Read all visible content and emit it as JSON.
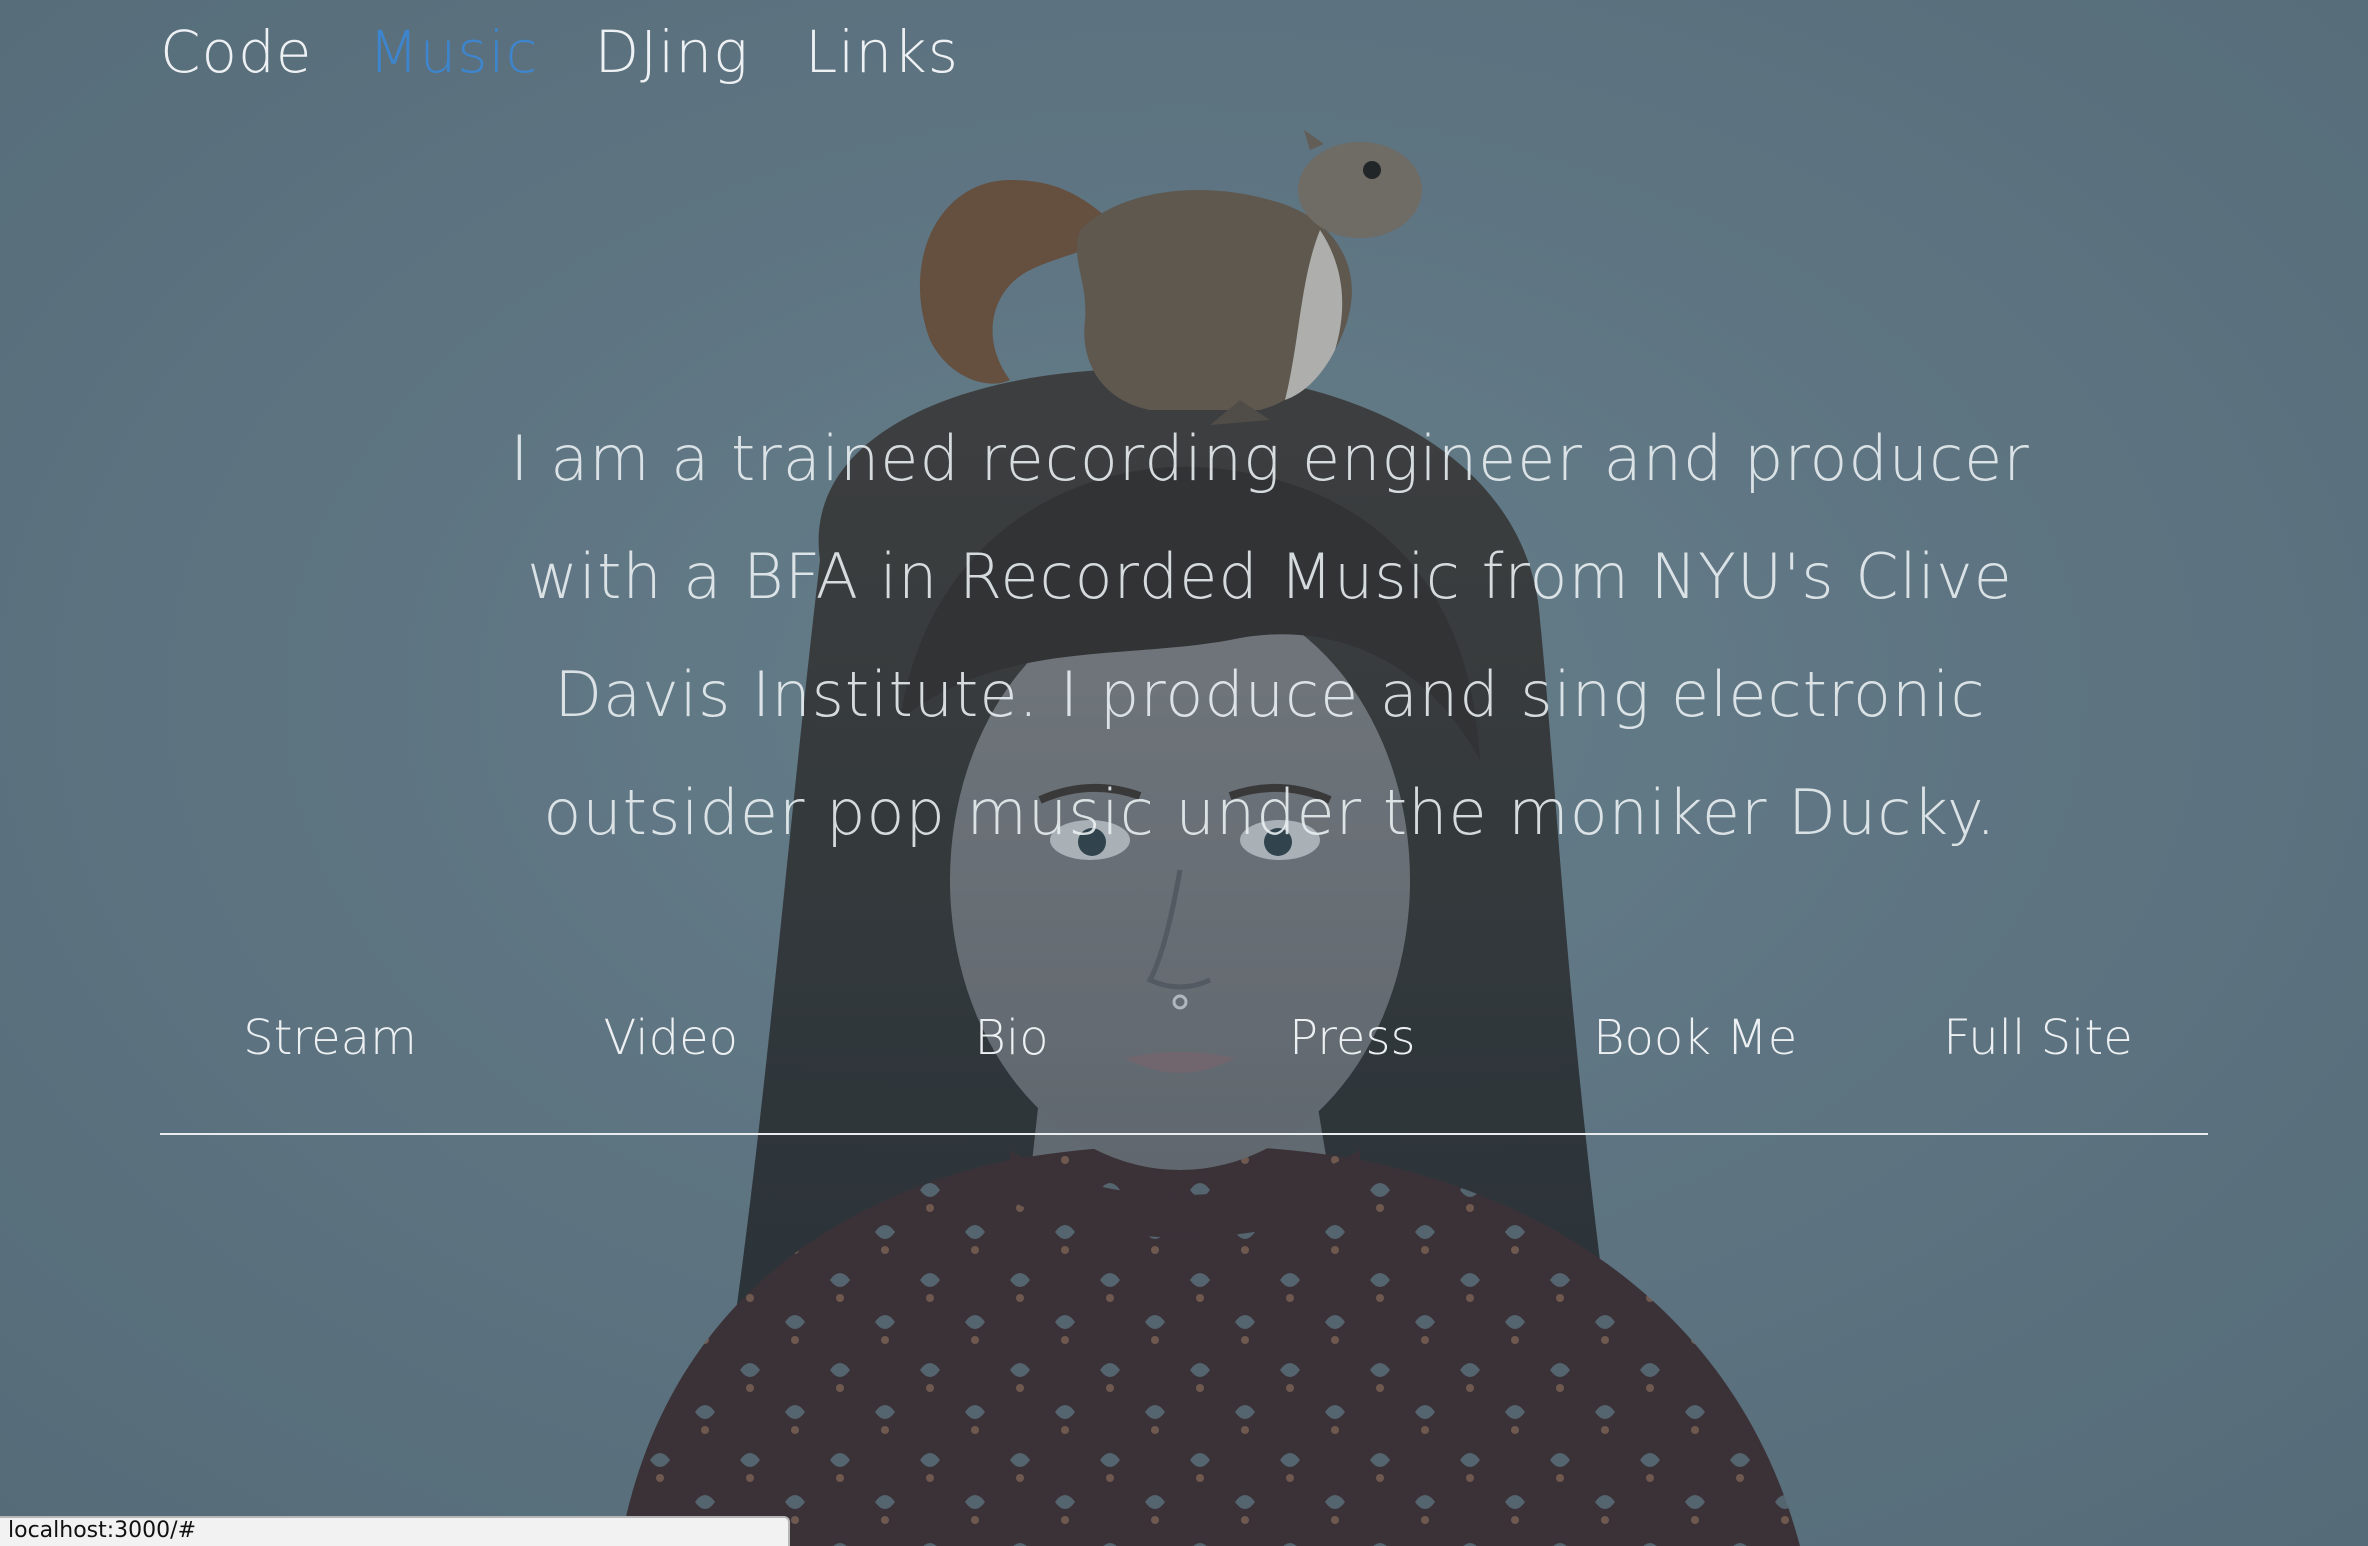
{
  "nav": {
    "items": [
      {
        "label": "Code",
        "active": false
      },
      {
        "label": "Music",
        "active": true
      },
      {
        "label": "DJing",
        "active": false
      },
      {
        "label": "Links",
        "active": false
      }
    ]
  },
  "intro": {
    "text": "I am a trained recording engineer and producer with a BFA in Recorded Music from NYU's Clive Davis Institute. I produce and sing electronic outsider pop music under the moniker Ducky."
  },
  "sub_nav": {
    "items": [
      {
        "label": "Stream"
      },
      {
        "label": "Video"
      },
      {
        "label": "Bio"
      },
      {
        "label": "Press"
      },
      {
        "label": "Book Me"
      },
      {
        "label": "Full Site"
      }
    ]
  },
  "status_bar": {
    "url": "localhost:3000/#"
  },
  "colors": {
    "background": "#5f7480",
    "active_link": "#3d86cf",
    "text": "#eef1f3"
  }
}
